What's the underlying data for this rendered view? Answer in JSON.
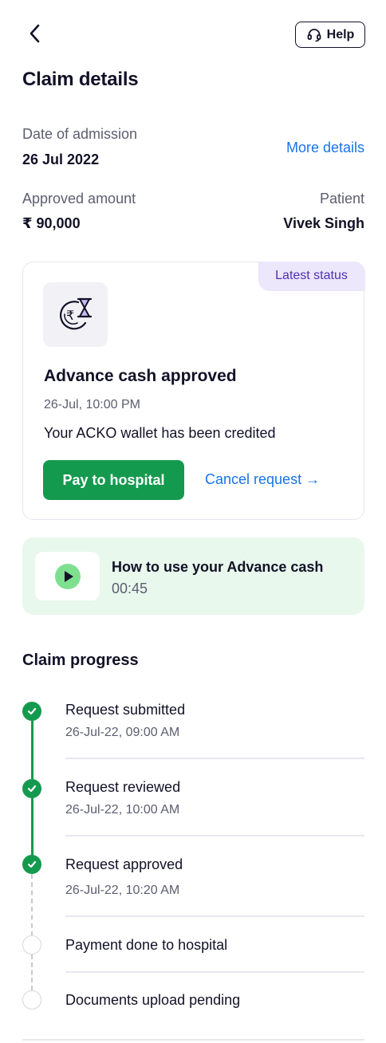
{
  "header": {
    "help_label": "Help",
    "title": "Claim details"
  },
  "summary": {
    "admission_label": "Date of admission",
    "admission_value": "26 Jul 2022",
    "more_details_label": "More details",
    "approved_label": "Approved amount",
    "approved_value": "₹ 90,000",
    "patient_label": "Patient",
    "patient_value": "Vivek Singh"
  },
  "status_card": {
    "badge": "Latest status",
    "icon": "rupee-hourglass-icon",
    "title": "Advance cash approved",
    "time": "26-Jul, 10:00 PM",
    "message": "Your ACKO wallet has been credited",
    "primary_button": "Pay to hospital",
    "secondary_link": "Cancel request →"
  },
  "video": {
    "icon": "play-icon",
    "title": "How to use your Advance cash",
    "duration": "00:45"
  },
  "progress": {
    "title": "Claim progress",
    "steps": [
      {
        "title": "Request submitted",
        "time": "26-Jul-22, 09:00 AM",
        "status": "done"
      },
      {
        "title": "Request reviewed",
        "time": "26-Jul-22, 10:00 AM",
        "status": "done"
      },
      {
        "title": "Request approved",
        "time": "26-Jul-22, 10:20 AM",
        "status": "done"
      },
      {
        "title": "Payment done to hospital",
        "time": "",
        "status": "pending"
      },
      {
        "title": "Documents upload pending",
        "time": "",
        "status": "pending"
      }
    ]
  },
  "colors": {
    "accent_green": "#149a4e",
    "link_blue": "#1b73e8",
    "badge_purple": "#4b31b2",
    "video_bg": "#e8f8ec"
  }
}
